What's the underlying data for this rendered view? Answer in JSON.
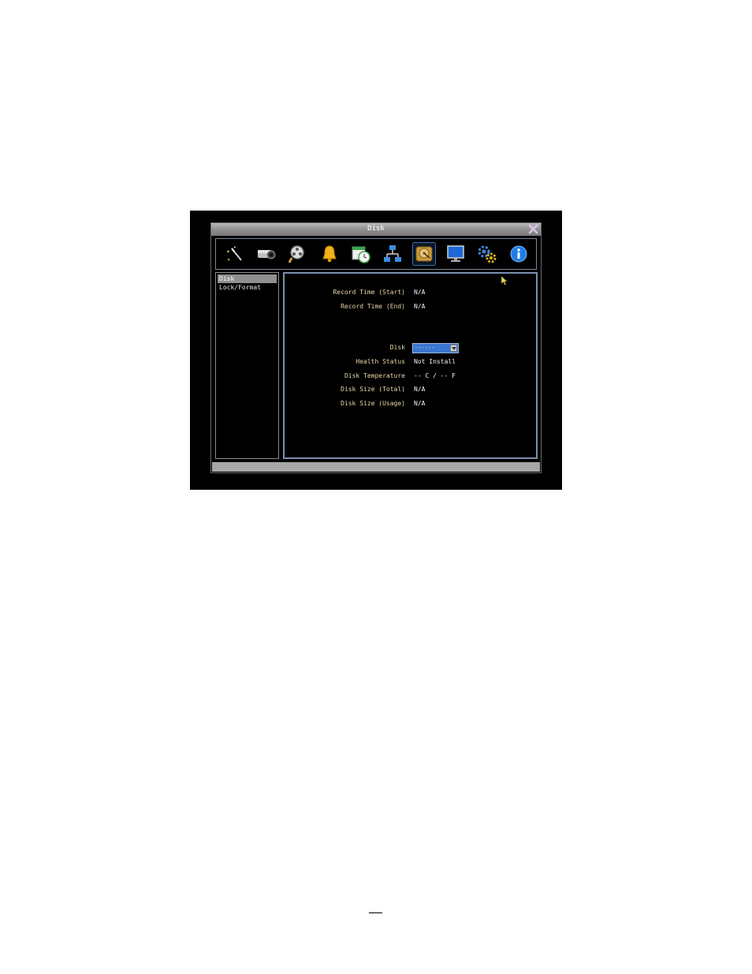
{
  "window": {
    "title": "Disk"
  },
  "toolbar": {
    "icons": [
      "wizard-icon",
      "camera-icon",
      "search-playback-icon",
      "alarm-bell-icon",
      "schedule-icon",
      "network-icon",
      "disk-icon",
      "display-monitor-icon",
      "system-settings-icon",
      "info-icon"
    ],
    "selected": "disk-icon"
  },
  "sidebar": {
    "items": [
      {
        "label": "Disk"
      },
      {
        "label": "Lock/Format"
      }
    ]
  },
  "record": {
    "start_label": "Record Time (Start)",
    "start_value": "N/A",
    "end_label": "Record Time (End)",
    "end_value": "N/A"
  },
  "disk": {
    "label": "Disk",
    "selected": "------",
    "health_label": "Health Status",
    "health_value": "Not Install",
    "temp_label": "Disk Temperature",
    "temp_value": "-- C / -- F",
    "size_total_label": "Disk Size (Total)",
    "size_total_value": "N/A",
    "size_usage_label": "Disk Size (Usage)",
    "size_usage_value": "N/A"
  },
  "colors": {
    "accent": "#3a76d0",
    "label": "#e8d8a8",
    "value": "#f2f2f2"
  }
}
